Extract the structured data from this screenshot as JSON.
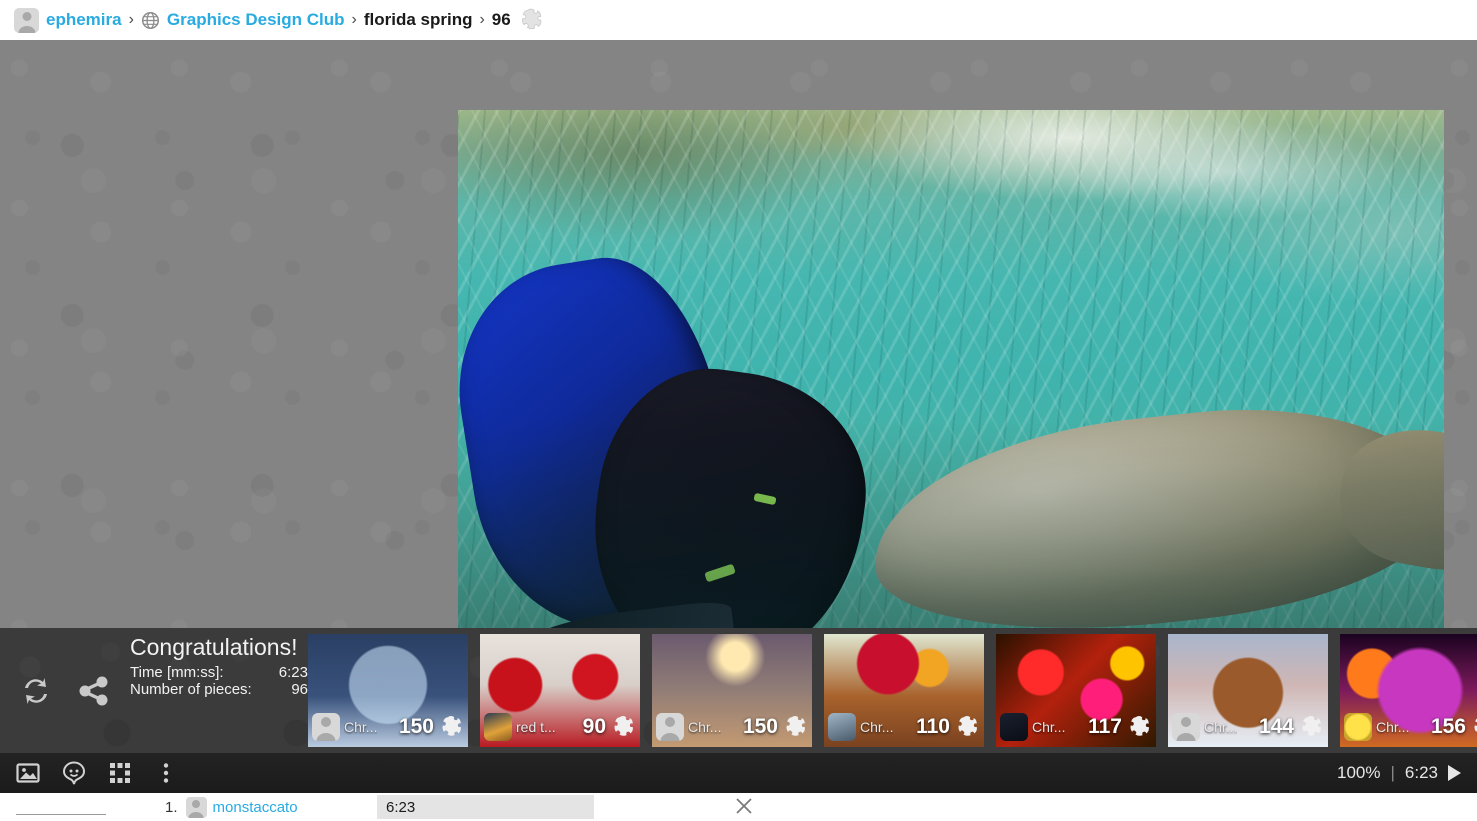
{
  "breadcrumb": {
    "user_icon": "user-avatar-icon",
    "user": "ephemira",
    "sep1": "›",
    "group_icon": "globe-icon",
    "group": "Graphics Design Club",
    "sep2": "›",
    "puzzle_name": "florida spring",
    "sep3": "›",
    "piece_count": "96",
    "piece_icon": "puzzle-piece-icon"
  },
  "board": {
    "image_alt": "snorkelers photographing a manatee in a florida spring",
    "background_color": "#848484"
  },
  "congrats": {
    "title": "Congratulations!",
    "time_label": "Time [mm:ss]:",
    "time_value": "6:23",
    "pieces_label": "Number of pieces:",
    "pieces_value": "96",
    "replay_icon": "refresh-icon",
    "share_icon": "share-icon"
  },
  "cards": [
    {
      "title": "Chr...",
      "count": "150",
      "avatar": "generic",
      "theme": "snowglobe"
    },
    {
      "title": "red t...",
      "count": "90",
      "avatar": "photo",
      "theme": "redtable"
    },
    {
      "title": "Chr...",
      "count": "150",
      "avatar": "generic",
      "theme": "winterforest"
    },
    {
      "title": "Chr...",
      "count": "110",
      "avatar": "photo",
      "theme": "fruitcake"
    },
    {
      "title": "Chr...",
      "count": "117",
      "avatar": "photo",
      "theme": "lights"
    },
    {
      "title": "Chr...",
      "count": "144",
      "avatar": "generic",
      "theme": "gingerbread"
    },
    {
      "title": "Chr...",
      "count": "156",
      "avatar": "photo",
      "theme": "christmastree"
    }
  ],
  "toolbar": {
    "icons": [
      {
        "name": "image-icon"
      },
      {
        "name": "ghost-piece-icon"
      },
      {
        "name": "grid-pieces-icon"
      },
      {
        "name": "more-options-icon"
      }
    ],
    "zoom": "100%",
    "separator": "|",
    "timer": "6:23",
    "play_icon": "play-icon"
  },
  "leaderboard": {
    "rank": "1.",
    "avatar_icon": "user-avatar-icon",
    "user": "monstaccato",
    "time": "6:23",
    "close_icon": "close-icon"
  }
}
